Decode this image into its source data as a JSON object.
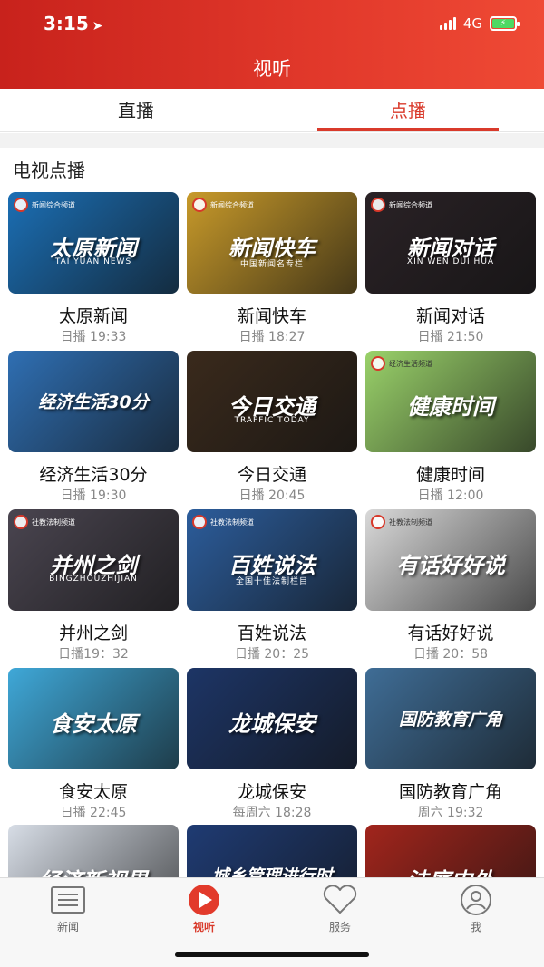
{
  "status": {
    "time": "3:15",
    "network": "4G"
  },
  "header": {
    "title": "视听"
  },
  "tabs": [
    {
      "label": "直播",
      "active": false
    },
    {
      "label": "点播",
      "active": true
    }
  ],
  "section": {
    "title": "电视点播"
  },
  "programs": [
    {
      "name": "太原新闻",
      "time": "日播 19:33",
      "thumb_text": "太原新闻",
      "thumb_sub": "TAI YUAN NEWS",
      "channel": "新闻综合频道",
      "bg": "#1b6fb5"
    },
    {
      "name": "新闻快车",
      "time": "日播 18:27",
      "thumb_text": "新闻快车",
      "thumb_sub": "中国新闻名专栏",
      "channel": "新闻综合频道",
      "bg": "#c89a2a"
    },
    {
      "name": "新闻对话",
      "time": "日播 21:50",
      "thumb_text": "新闻对话",
      "thumb_sub": "XIN  WEN  DUI  HUA",
      "channel": "新闻综合频道",
      "bg": "#2a2226"
    },
    {
      "name": "经济生活30分",
      "time": "日播 19:30",
      "thumb_text": "经济生活30分",
      "thumb_sub": "",
      "channel": "",
      "bg": "#2f6fb3"
    },
    {
      "name": "今日交通",
      "time": "日播 20:45",
      "thumb_text": "今日交通",
      "thumb_sub": "TRAFFIC TODAY",
      "channel": "",
      "bg": "#3a2a1c"
    },
    {
      "name": "健康时间",
      "time": "日播 12:00",
      "thumb_text": "健康时间",
      "thumb_sub": "",
      "channel": "经济生活频道",
      "bg": "#9ad26a"
    },
    {
      "name": "并州之剑",
      "time": "日播19：32",
      "thumb_text": "并州之剑",
      "thumb_sub": "BINGZHOUZHIJIAN",
      "channel": "社教法制频道",
      "bg": "#4a4550"
    },
    {
      "name": "百姓说法",
      "time": "日播 20：25",
      "thumb_text": "百姓说法",
      "thumb_sub": "全国十佳法制栏目",
      "channel": "社教法制频道",
      "bg": "#2c5d9c"
    },
    {
      "name": "有话好好说",
      "time": "日播 20：58",
      "thumb_text": "有话好好说",
      "thumb_sub": "",
      "channel": "社教法制频道",
      "bg": "#d9d9d9"
    },
    {
      "name": "食安太原",
      "time": "日播 22:45",
      "thumb_text": "食安太原",
      "thumb_sub": "",
      "channel": "",
      "bg": "#3fa8d8"
    },
    {
      "name": "龙城保安",
      "time": "每周六 18:28",
      "thumb_text": "龙城保安",
      "thumb_sub": "",
      "channel": "",
      "bg": "#1d3566"
    },
    {
      "name": "国防教育广角",
      "time": "周六 19:32",
      "thumb_text": "国防教育广角",
      "thumb_sub": "",
      "channel": "",
      "bg": "#3f6d96"
    },
    {
      "name": "",
      "time": "",
      "thumb_text": "经济新视界",
      "thumb_sub": "",
      "channel": "",
      "bg": "#d7dde6"
    },
    {
      "name": "",
      "time": "",
      "thumb_text": "城乡管理进行时",
      "thumb_sub": "",
      "channel": "",
      "bg": "#1f3b73"
    },
    {
      "name": "",
      "time": "",
      "thumb_text": "法庭内外",
      "thumb_sub": "",
      "channel": "",
      "bg": "#a1251c"
    }
  ],
  "tabbar": [
    {
      "label": "新闻",
      "icon": "newspaper-icon",
      "active": false
    },
    {
      "label": "视听",
      "icon": "play-circle-icon",
      "active": true
    },
    {
      "label": "服务",
      "icon": "heart-icon",
      "active": false
    },
    {
      "label": "我",
      "icon": "user-icon",
      "active": false
    }
  ],
  "colors": {
    "accent": "#d93a2b",
    "header_start": "#c8221c",
    "header_end": "#ef4a35"
  }
}
